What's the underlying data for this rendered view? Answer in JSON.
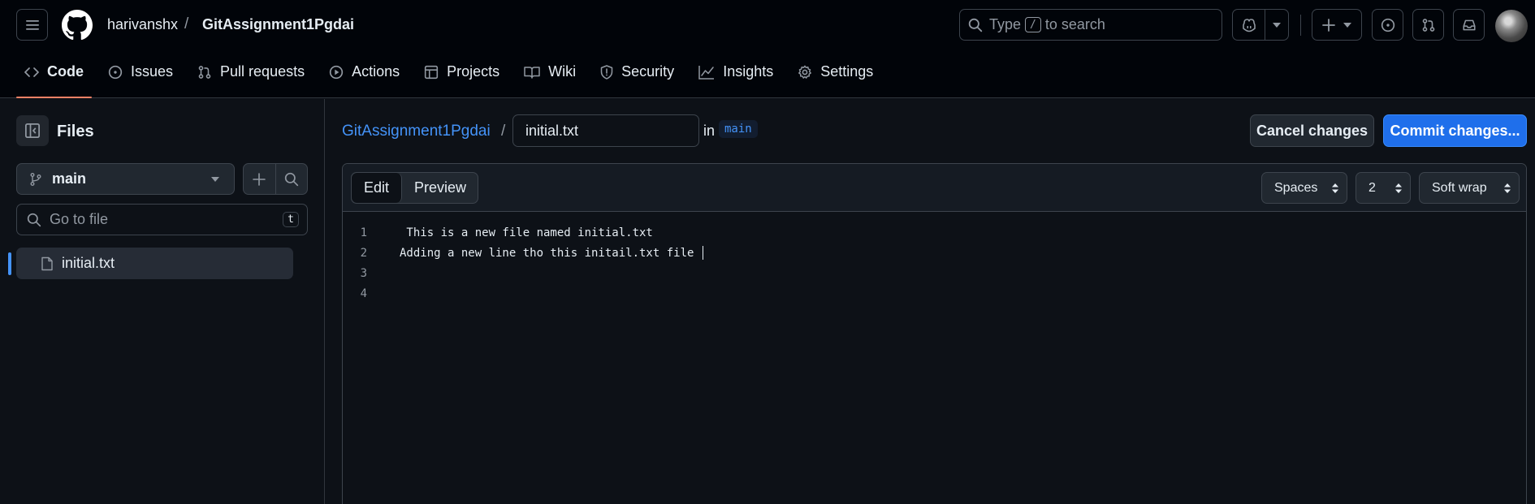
{
  "header": {
    "owner": "harivanshx",
    "separator": "/",
    "repo": "GitAssignment1Pgdai",
    "search": {
      "prefix": "Type",
      "key": "/",
      "suffix": "to search"
    }
  },
  "nav": {
    "code": "Code",
    "issues": "Issues",
    "pull_requests": "Pull requests",
    "actions": "Actions",
    "projects": "Projects",
    "wiki": "Wiki",
    "security": "Security",
    "insights": "Insights",
    "settings": "Settings"
  },
  "sidebar": {
    "title": "Files",
    "branch": "main",
    "goto_placeholder": "Go to file",
    "goto_shortcut": "t",
    "files": [
      "initial.txt"
    ]
  },
  "editor": {
    "breadcrumb_repo": "GitAssignment1Pgdai",
    "breadcrumb_sep": "/",
    "filename": "initial.txt",
    "in_label": "in",
    "branch": "main",
    "cancel_label": "Cancel changes",
    "commit_label": "Commit changes...",
    "tab_edit": "Edit",
    "tab_preview": "Preview",
    "indent_mode": "Spaces",
    "indent_size": "2",
    "wrap_mode": "Soft wrap",
    "lines": [
      {
        "num": "1",
        "text": " This is a new file named initial.txt"
      },
      {
        "num": "2",
        "text": "Adding a new line tho this initail.txt file "
      },
      {
        "num": "3",
        "text": ""
      },
      {
        "num": "4",
        "text": ""
      }
    ]
  },
  "colors": {
    "accent_blue": "#1f6feb",
    "link_blue": "#4493f8",
    "nav_underline": "#f78166",
    "background": "#0d1117"
  }
}
